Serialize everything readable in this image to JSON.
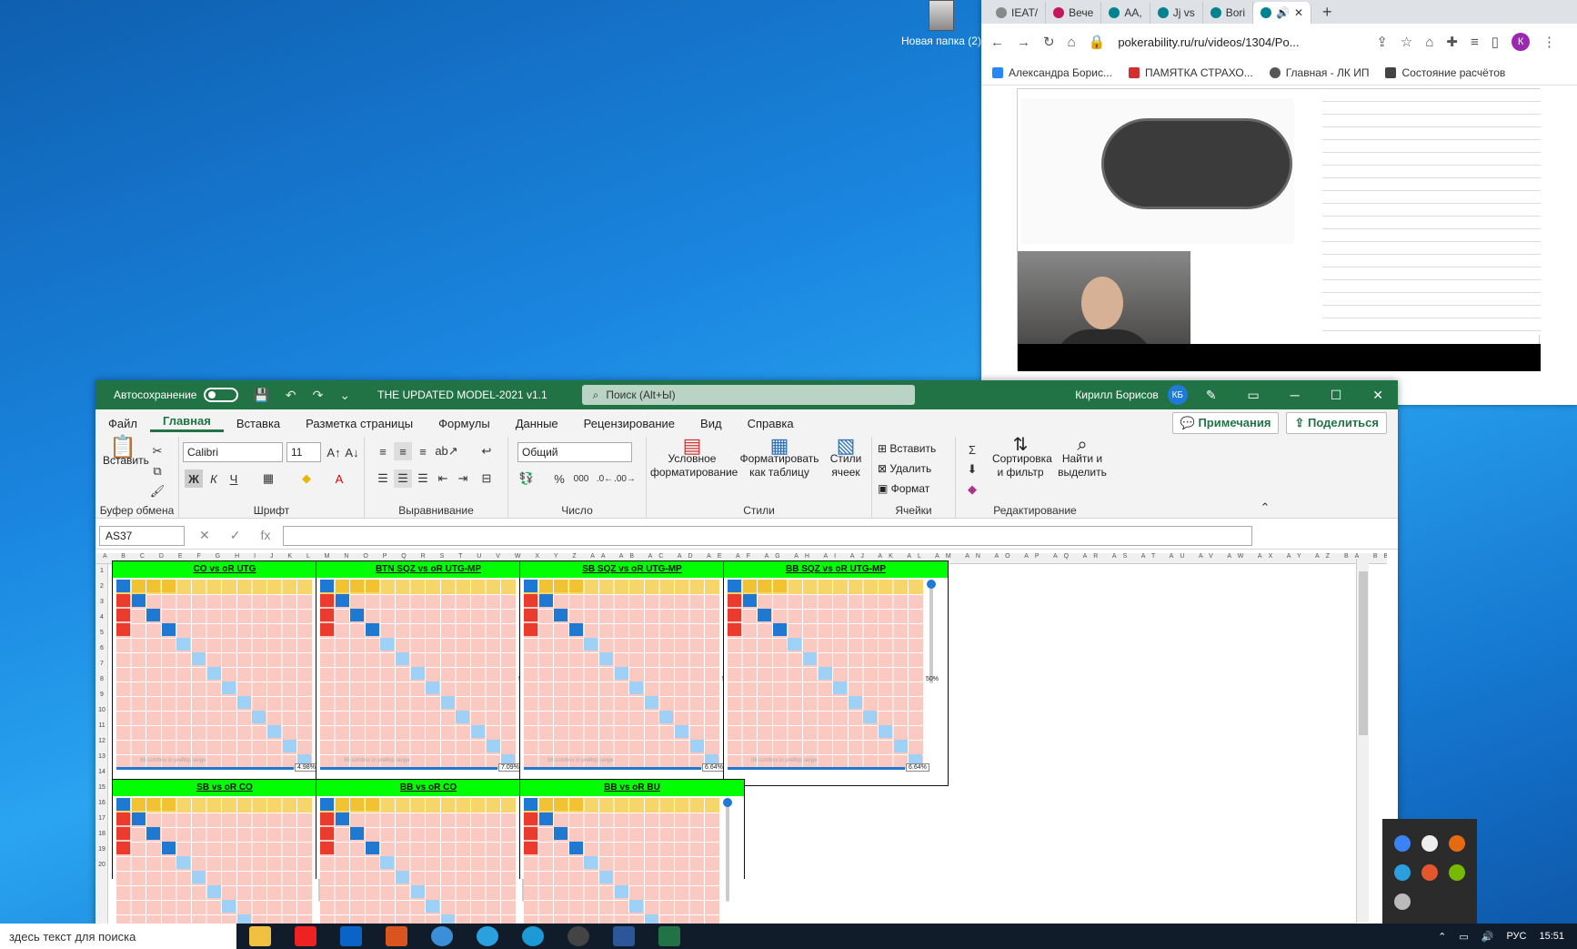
{
  "desktop": {
    "icon_label": "Новая папка (2)"
  },
  "chrome": {
    "tabs": [
      {
        "label": "IEAT/"
      },
      {
        "label": "Вече"
      },
      {
        "label": "AA,"
      },
      {
        "label": "Jj vs"
      },
      {
        "label": "Bori"
      },
      {
        "label": ""
      }
    ],
    "url": "pokerability.ru/ru/videos/1304/Po...",
    "profile": "К",
    "bookmarks": [
      "Александра Борис...",
      "ПАМЯТКА СТРАХО...",
      "Главная - ЛК ИП",
      "Состояние расчётов"
    ]
  },
  "excel": {
    "autosave_label": "Автосохранение",
    "file_title": "THE UPDATED MODEL-2021 v1.1",
    "search_placeholder": "Поиск (Alt+Ы)",
    "user_name": "Кирилл Борисов",
    "user_initials": "КБ",
    "menus": [
      "Файл",
      "Главная",
      "Вставка",
      "Разметка страницы",
      "Формулы",
      "Данные",
      "Рецензирование",
      "Вид",
      "Справка"
    ],
    "comments_button": "Примечания",
    "share_button": "Поделиться",
    "ribbon": {
      "paste": "Вставить",
      "clipboard": "Буфер обмена",
      "font_name": "Calibri",
      "font_size": "11",
      "bold": "Ж",
      "italic": "К",
      "underline": "Ч",
      "font": "Шрифт",
      "alignment": "Выравнивание",
      "number_format": "Общий",
      "number": "Число",
      "cond_format": "Условное форматирование",
      "format_table": "Форматировать как таблицу",
      "cell_styles": "Стили ячеек",
      "styles": "Стили",
      "insert": "Вставить",
      "delete": "Удалить",
      "format": "Формат",
      "cells": "Ячейки",
      "sort_filter": "Сортировка и фильтр",
      "find_select": "Найти и выделить",
      "editing": "Редактирование"
    },
    "name_box": "AS37",
    "panels": [
      {
        "title": "CO vs oR UTG",
        "combos": "86 combos in preflop range",
        "pct": "4.98%"
      },
      {
        "title": "BTN SQZ vs oR UTG-MP",
        "combos": "96 combos in preflop range",
        "pct": "7.09%",
        "mid": "50%"
      },
      {
        "title": "SB SQZ vs oR UTG-MP",
        "combos": "88 combos in preflop range",
        "pct": "6.64%",
        "mid": "50%"
      },
      {
        "title": "BB SQZ vs oR UTG-MP",
        "combos": "88 combos in preflop range",
        "pct": "6.64%",
        "mid": "50%"
      },
      {
        "title": "SB vs oR CO"
      },
      {
        "title": "BB vs oR CO"
      },
      {
        "title": "BB vs oR BU"
      }
    ]
  },
  "taskbar": {
    "search_text": "здесь текст для поиска",
    "lang": "РУС",
    "time": "15:51"
  }
}
